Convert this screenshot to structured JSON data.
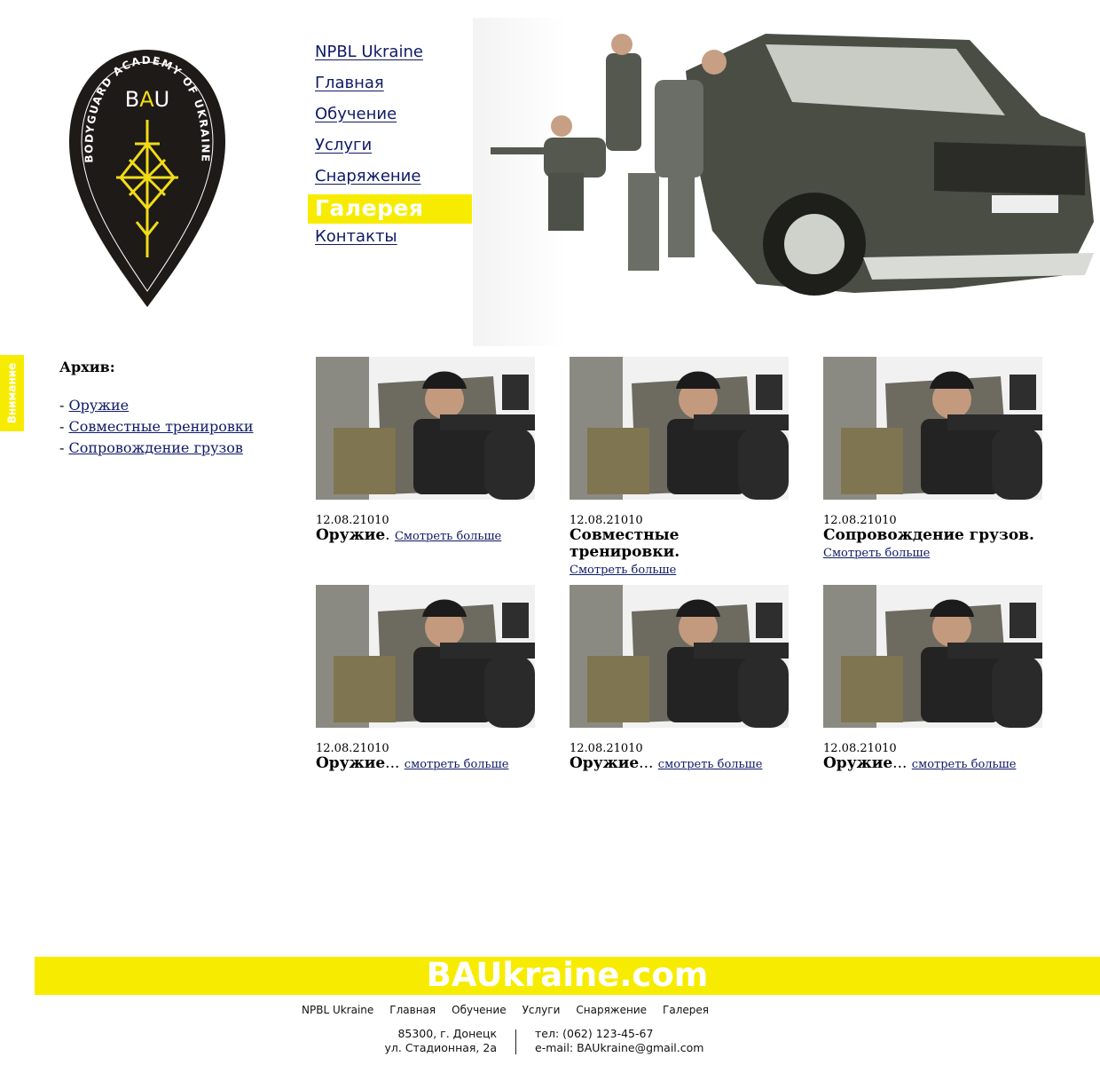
{
  "side_tab": {
    "label": "Внимание"
  },
  "logo": {
    "abbr_b": "B",
    "abbr_a": "A",
    "abbr_u": "U",
    "ring_text": "BODYGUARD ACADEMY OF UKRAINE"
  },
  "nav": {
    "items": [
      {
        "label": "NPBL Ukraine"
      },
      {
        "label": "Главная"
      },
      {
        "label": "Обучение"
      },
      {
        "label": "Услуги"
      },
      {
        "label": "Снаряжение"
      },
      {
        "label": "Галерея"
      },
      {
        "label": "Контакты"
      }
    ],
    "active": "Галерея"
  },
  "archive": {
    "title": "Архив:",
    "items": [
      {
        "label": "Оружие"
      },
      {
        "label": "Совместные тренировки"
      },
      {
        "label": "Сопровождение грузов"
      }
    ]
  },
  "gallery": {
    "cards": [
      {
        "date": "12.08.21010",
        "title": "Оружие",
        "sep": ". ",
        "more": "Смотреть больше"
      },
      {
        "date": "12.08.21010",
        "title": "Совместные тренировки.",
        "sep": "",
        "more": "Смотреть больше"
      },
      {
        "date": "12.08.21010",
        "title": "Сопровождение грузов.",
        "sep": "",
        "more": "Смотреть больше"
      },
      {
        "date": "12.08.21010",
        "title": "Оружие",
        "sep": "... ",
        "more": "смотреть больше"
      },
      {
        "date": "12.08.21010",
        "title": "Оружие",
        "sep": "... ",
        "more": "смотреть больше"
      },
      {
        "date": "12.08.21010",
        "title": "Оружие",
        "sep": "... ",
        "more": "смотреть больше"
      }
    ]
  },
  "footer": {
    "site": "BAUkraine.com",
    "nav": [
      "NPBL Ukraine",
      "Главная",
      "Обучение",
      "Услуги",
      "Снаряжение",
      "Галерея"
    ],
    "address_line1": "85300, г. Донецк",
    "address_line2": "ул. Стадионная, 2а",
    "phone": "тел: (062) 123-45-67",
    "email": "e-mail: BAUkraine@gmail.com"
  },
  "colors": {
    "accent": "#f7ec00",
    "link": "#0f1a66",
    "logo_bg": "#1d1a18",
    "logo_gold": "#f2dc16"
  }
}
